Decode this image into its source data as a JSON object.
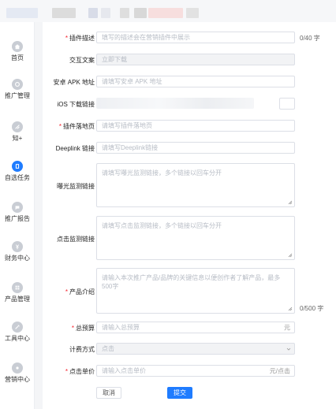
{
  "sidebar": {
    "items": [
      {
        "label": "首页",
        "icon": "home-icon",
        "active": false
      },
      {
        "label": "推广管理",
        "icon": "promotion-icon",
        "active": false
      },
      {
        "label": "知+",
        "icon": "zhi-plus-icon",
        "active": false
      },
      {
        "label": "自选任务",
        "icon": "task-icon",
        "active": true
      },
      {
        "label": "推广报告",
        "icon": "report-icon",
        "active": false
      },
      {
        "label": "财务中心",
        "icon": "yuan-icon",
        "active": false
      },
      {
        "label": "产品管理",
        "icon": "product-icon",
        "active": false
      },
      {
        "label": "工具中心",
        "icon": "tools-icon",
        "active": false
      },
      {
        "label": "营销中心",
        "icon": "marketing-icon",
        "active": false
      }
    ]
  },
  "form": {
    "plugin_desc": {
      "label": "插件描述",
      "placeholder": "填写的描述会在营销插件中展示",
      "counter": "0/40 字"
    },
    "interaction_text": {
      "label": "交互文案",
      "value": "立即下载"
    },
    "android_apk": {
      "label": "安卓 APK 地址",
      "placeholder": "请填写安卓 APK 地址"
    },
    "ios_link": {
      "label": "iOS 下载链接"
    },
    "landing_page": {
      "label": "插件落地页",
      "placeholder": "请填写插件落地页"
    },
    "deeplink": {
      "label": "Deeplink 链接",
      "placeholder": "请填写Deeplink链接"
    },
    "exposure_monitor": {
      "label": "曝光监测链接",
      "placeholder": "请填写曝光监测链接，多个链接以回车分开"
    },
    "click_monitor": {
      "label": "点击监测链接",
      "placeholder": "请填写点击监测链接，多个链接以回车分开"
    },
    "product_intro": {
      "label": "产品介绍",
      "placeholder": "请输入本次推广产品/品牌的关键信息以便创作者了解产品，最多500字",
      "counter": "0/500 字"
    },
    "total_budget": {
      "label": "总预算",
      "placeholder": "请输入总预算",
      "suffix": "元"
    },
    "billing_method": {
      "label": "计费方式",
      "value": "点击"
    },
    "click_price": {
      "label": "点击单价",
      "placeholder": "请输入点击单价",
      "suffix": "元/点击"
    }
  },
  "actions": {
    "cancel_label": "取消",
    "submit_label": "提交"
  },
  "colors": {
    "accent": "#1f7cff",
    "required": "#f5222d",
    "border": "#dcdfe6"
  }
}
